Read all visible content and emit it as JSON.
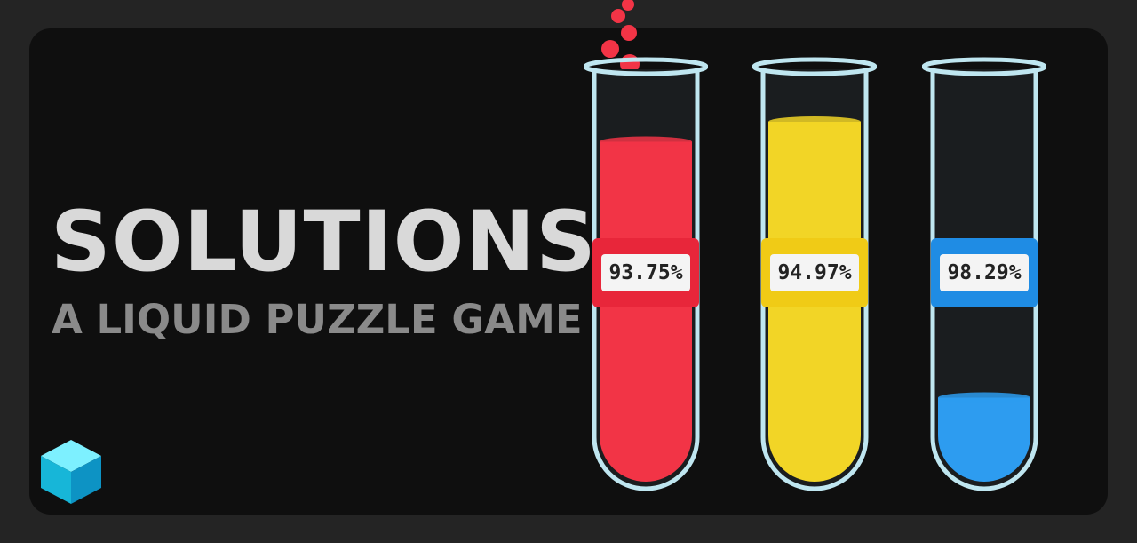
{
  "title": "SOLUTIONS",
  "subtitle": "A LIQUID PUZZLE GAME",
  "logo_icon": "cube-icon",
  "tubes": [
    {
      "label": "93.75%",
      "color": "#f23446",
      "band_color": "#e8263a",
      "fill_level": 0.85
    },
    {
      "label": "94.97%",
      "color": "#f2d526",
      "band_color": "#f0cb16",
      "fill_level": 0.9
    },
    {
      "label": "98.29%",
      "color": "#2d9cf0",
      "band_color": "#1f8ce4",
      "fill_level": 0.21
    }
  ]
}
